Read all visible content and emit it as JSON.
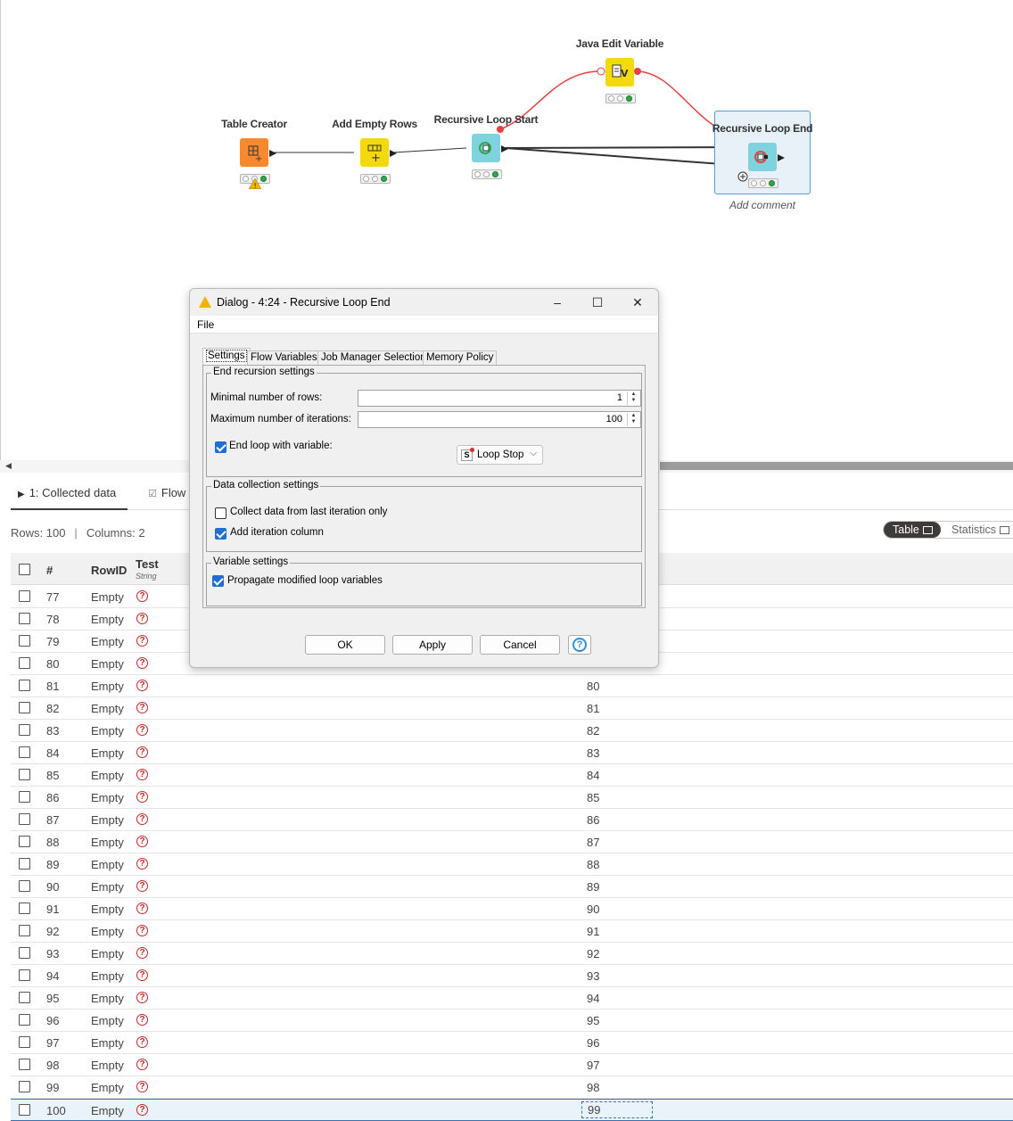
{
  "workflow": {
    "nodes": [
      {
        "title": "Table Creator",
        "color": "#f7892e",
        "icon": "table-creator-icon",
        "warning": true
      },
      {
        "title": "Add Empty Rows",
        "color": "#f5d90f",
        "icon": "add-rows-icon",
        "warning": false
      },
      {
        "title": "Recursive Loop Start",
        "color": "#7fd3de",
        "icon": "loop-start-icon",
        "warning": false
      },
      {
        "title": "Java Edit Variable",
        "color": "#f5d90f",
        "icon": "java-variable-icon",
        "warning": false
      },
      {
        "title": "Recursive Loop End",
        "color": "#7fd3de",
        "icon": "loop-end-icon",
        "warning": false
      }
    ],
    "add_comment": "Add comment",
    "colors": {
      "data_link": "#333333",
      "variable_link": "#e84040",
      "selection": "#5a9ad6"
    }
  },
  "panel": {
    "tabs": [
      {
        "label": "1: Collected data",
        "icon": "play-icon"
      },
      {
        "label": "Flow",
        "icon": "flow-variable-icon"
      }
    ],
    "rows_label": "Rows: 100",
    "columns_label": "Columns: 2",
    "view_switch": {
      "active": "Table",
      "inactive": "Statistics"
    },
    "table": {
      "headers": {
        "num": "#",
        "rowid": "RowID",
        "test": "Test",
        "test_type": "String"
      },
      "rows": [
        {
          "num": "77",
          "rowid": "Empty",
          "iter": ""
        },
        {
          "num": "78",
          "rowid": "Empty",
          "iter": ""
        },
        {
          "num": "79",
          "rowid": "Empty",
          "iter": ""
        },
        {
          "num": "80",
          "rowid": "Empty",
          "iter": ""
        },
        {
          "num": "81",
          "rowid": "Empty",
          "iter": "80"
        },
        {
          "num": "82",
          "rowid": "Empty",
          "iter": "81"
        },
        {
          "num": "83",
          "rowid": "Empty",
          "iter": "82"
        },
        {
          "num": "84",
          "rowid": "Empty",
          "iter": "83"
        },
        {
          "num": "85",
          "rowid": "Empty",
          "iter": "84"
        },
        {
          "num": "86",
          "rowid": "Empty",
          "iter": "85"
        },
        {
          "num": "87",
          "rowid": "Empty",
          "iter": "86"
        },
        {
          "num": "88",
          "rowid": "Empty",
          "iter": "87"
        },
        {
          "num": "89",
          "rowid": "Empty",
          "iter": "88"
        },
        {
          "num": "90",
          "rowid": "Empty",
          "iter": "89"
        },
        {
          "num": "91",
          "rowid": "Empty",
          "iter": "90"
        },
        {
          "num": "92",
          "rowid": "Empty",
          "iter": "91"
        },
        {
          "num": "93",
          "rowid": "Empty",
          "iter": "92"
        },
        {
          "num": "94",
          "rowid": "Empty",
          "iter": "93"
        },
        {
          "num": "95",
          "rowid": "Empty",
          "iter": "94"
        },
        {
          "num": "96",
          "rowid": "Empty",
          "iter": "95"
        },
        {
          "num": "97",
          "rowid": "Empty",
          "iter": "96"
        },
        {
          "num": "98",
          "rowid": "Empty",
          "iter": "97"
        },
        {
          "num": "99",
          "rowid": "Empty",
          "iter": "98"
        },
        {
          "num": "100",
          "rowid": "Empty",
          "iter": "99"
        }
      ],
      "missing_symbol": "?"
    }
  },
  "dialog": {
    "title": "Dialog - 4:24 - Recursive Loop End",
    "menu": "File",
    "tabs": [
      "Settings",
      "Flow Variables",
      "Job Manager Selection",
      "Memory Policy"
    ],
    "end_recursion": {
      "title": "End recursion settings",
      "min_rows_label": "Minimal number of rows:",
      "min_rows_value": "1",
      "max_iter_label": "Maximum number of iterations:",
      "max_iter_value": "100",
      "end_loop_label": "End loop with variable:",
      "end_loop_checked": true,
      "variable": "Loop Stop",
      "variable_type_icon": "S"
    },
    "data_collection": {
      "title": "Data collection settings",
      "last_iter_label": "Collect data from last iteration only",
      "last_iter_checked": false,
      "add_iter_label": "Add iteration column",
      "add_iter_checked": true
    },
    "variable_settings": {
      "title": "Variable settings",
      "propagate_label": "Propagate modified loop variables",
      "propagate_checked": true
    },
    "buttons": {
      "ok": "OK",
      "apply": "Apply",
      "cancel": "Cancel",
      "help": "?"
    },
    "window_controls": {
      "minimize": "–",
      "maximize": "☐",
      "close": "✕"
    }
  }
}
